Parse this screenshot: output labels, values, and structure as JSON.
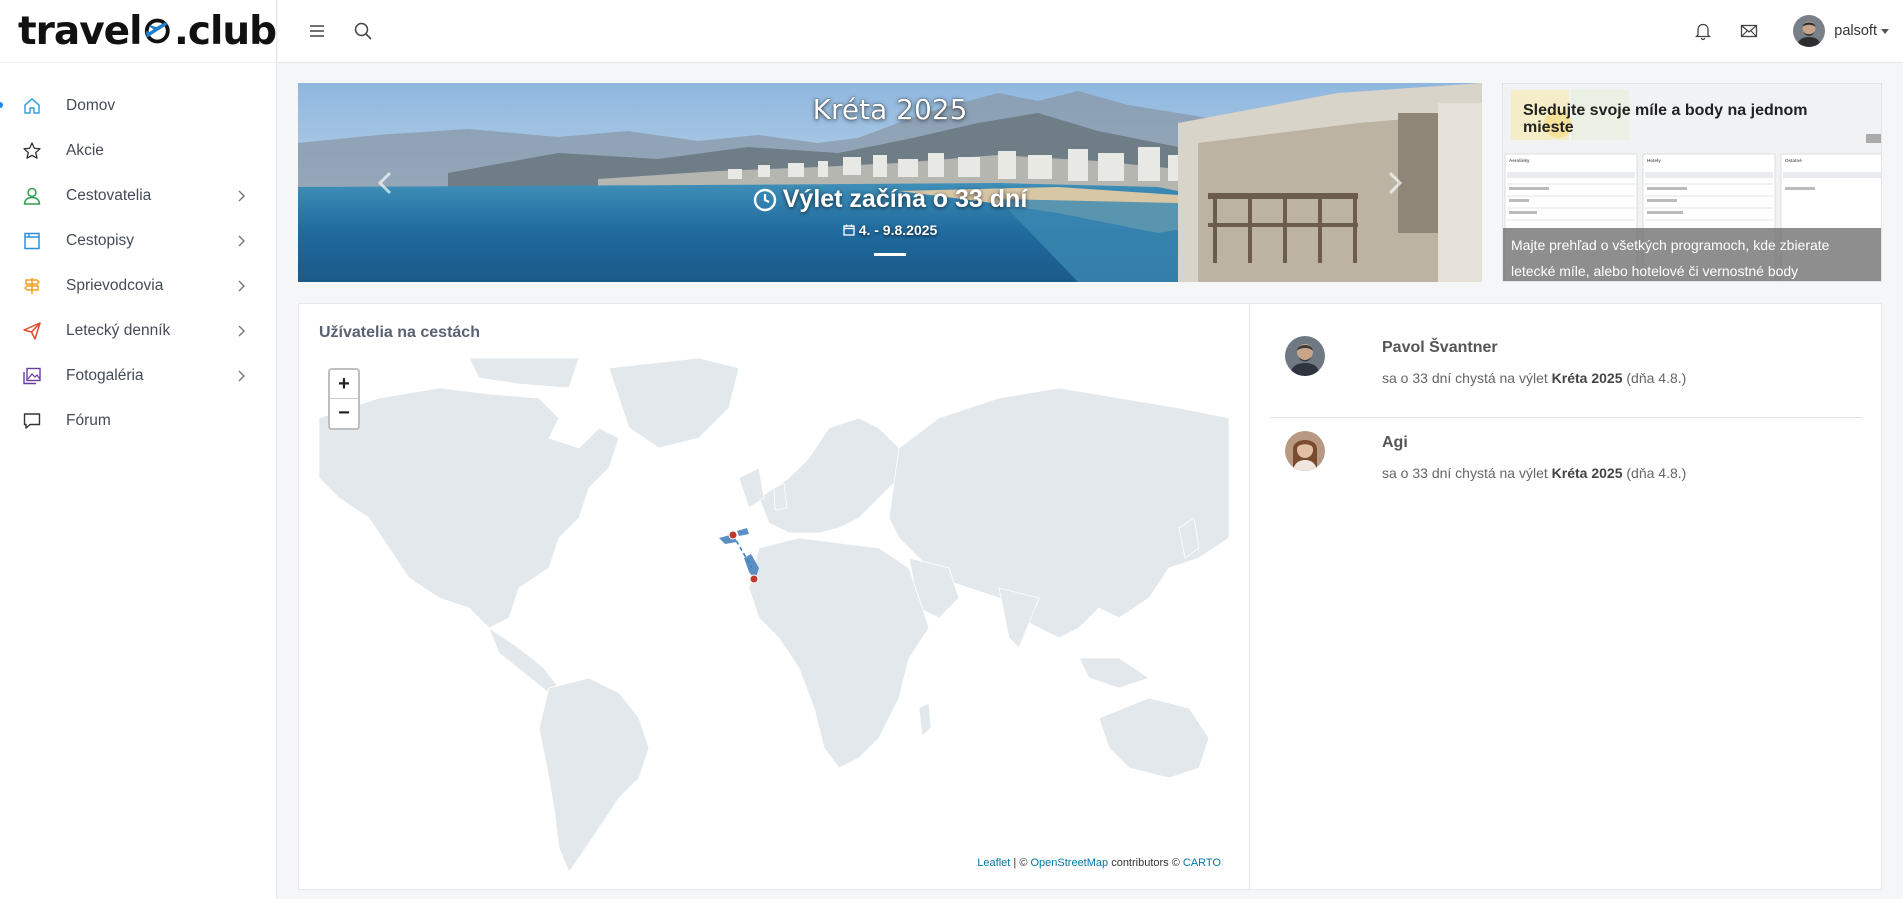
{
  "brand": {
    "name_prefix": "travel",
    "name_suffix": ".club"
  },
  "sidebar": {
    "items": [
      {
        "label": "Domov",
        "icon": "home-icon",
        "color": "#3aa0e0",
        "active": true
      },
      {
        "label": "Akcie",
        "icon": "star-icon",
        "color": "#333333"
      },
      {
        "label": "Cestovatelia",
        "icon": "user-icon",
        "color": "#2e9e4e",
        "expandable": true
      },
      {
        "label": "Cestopisy",
        "icon": "book-icon",
        "color": "#2b8fd8",
        "expandable": true
      },
      {
        "label": "Sprievodcovia",
        "icon": "signpost-icon",
        "color": "#f0a020",
        "expandable": true
      },
      {
        "label": "Letecký denník",
        "icon": "paper-plane-icon",
        "color": "#e24a2a",
        "expandable": true
      },
      {
        "label": "Fotogaléria",
        "icon": "gallery-icon",
        "color": "#6a3aa8",
        "expandable": true
      },
      {
        "label": "Fórum",
        "icon": "comment-icon",
        "color": "#333333"
      }
    ]
  },
  "topbar": {
    "username": "palsoft"
  },
  "hero": {
    "title": "Kréta 2025",
    "subtitle": "Výlet začína o 33 dní",
    "dates": "4. - 9.8.2025"
  },
  "promo": {
    "title": "Sledujte svoje míle a body na jednom mieste",
    "caption": "Majte prehľad o všetkých programoch, kde zbierate letecké míle, alebo hotelové či vernostné body",
    "mini_headers": [
      "Aerolinky",
      "Hotely",
      "Ostatné"
    ]
  },
  "panel": {
    "title": "Užívatelia na cestách",
    "attribution": {
      "leaflet": "Leaflet",
      "sep": " | © ",
      "osm": "OpenStreetMap",
      "contrib": " contributors © ",
      "carto": "CARTO"
    }
  },
  "trips": [
    {
      "name": "Pavol Švantner",
      "pre": "sa o 33 dní chystá na výlet ",
      "trip": "Kréta 2025",
      "post": " (dňa 4.8.)"
    },
    {
      "name": "Agi",
      "pre": "sa o 33 dní chystá na výlet ",
      "trip": "Kréta 2025",
      "post": " (dňa 4.8.)"
    }
  ],
  "colors": {
    "accent": "#1e88e5",
    "land": "#dfe6ec",
    "route": "#3a7fc1",
    "marker": "#c0392b"
  }
}
